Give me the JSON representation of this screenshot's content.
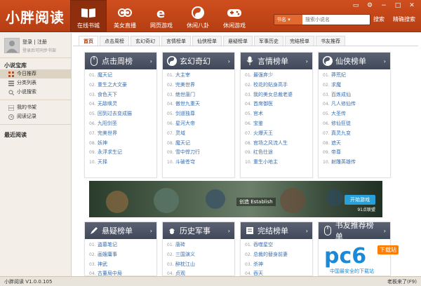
{
  "app": {
    "logo": "小胖阅读",
    "version": "小胖阅读 V1.0.0.105",
    "boss_key": "老板来了(F9)"
  },
  "nav": [
    {
      "label": "在线书城",
      "icon": "book-icon",
      "active": true
    },
    {
      "label": "美女直播",
      "icon": "owl-icon",
      "active": false
    },
    {
      "label": "网页游戏",
      "icon": "ie-icon",
      "active": false
    },
    {
      "label": "休闲八卦",
      "icon": "yinyang-icon",
      "active": false
    },
    {
      "label": "休闲游戏",
      "icon": "gamepad-icon",
      "active": false
    }
  ],
  "search": {
    "type": "书名",
    "placeholder": "搜索小说名",
    "button": "搜索",
    "precise": "精确搜索"
  },
  "sidebar": {
    "login": "登录",
    "sep": "|",
    "logout": "注册",
    "login_sub": "登录后可同步书架",
    "section1": "小说宝库",
    "items": [
      "今日推荐",
      "分类列表",
      "小说搜索"
    ],
    "items2": [
      "我的书架",
      "阅读记录"
    ],
    "section2": "最近阅读"
  },
  "tabs": [
    "首页",
    "点击周榜",
    "玄幻奇幻",
    "言情榜单",
    "仙侠榜单",
    "悬疑榜单",
    "军事历史",
    "完结榜单",
    "书友推荐"
  ],
  "panels": [
    {
      "title": "点击周榜",
      "icon": "mouse-icon",
      "items": [
        "魔天记",
        "重生之大文豪",
        "食色天下",
        "无敌唤灵",
        "回到过去变成猫",
        "九阳剑圣",
        "完美世界",
        "妖神",
        "永浮求生记",
        "天择"
      ]
    },
    {
      "title": "玄幻奇幻",
      "icon": "yinyang-icon",
      "items": [
        "大主宰",
        "完美世界",
        "绝世唐门",
        "傲世九重天",
        "剑道独尊",
        "星河大帝",
        "灵域",
        "魔天记",
        "雪中悍刀行",
        "斗破苍穹"
      ]
    },
    {
      "title": "言情榜单",
      "icon": "mic-icon",
      "items": [
        "最强弃少",
        "校花的贴身高手",
        "我的美女总裁老婆",
        "首席御医",
        "官术",
        "宝鉴",
        "火爆天王",
        "官场之风流人生",
        "红色仕途",
        "重生小地主"
      ]
    },
    {
      "title": "仙侠榜单",
      "icon": "yinyang-icon",
      "items": [
        "莽荒纪",
        "求魔",
        "百炼成仙",
        "凡人修仙传",
        "大圣传",
        "修仙狂徒",
        "真灵九变",
        "遮天",
        "帝尊",
        "射雕英雄传"
      ]
    }
  ],
  "panels2": [
    {
      "title": "悬疑榜单",
      "icon": "pen-icon",
      "items": [
        "盗墓笔记",
        "画嫂庸事",
        "神武",
        "古董局中局"
      ]
    },
    {
      "title": "历史军事",
      "icon": "soldier-icon",
      "items": [
        "唐砖",
        "三国演义",
        "醉枕江山",
        "贞观"
      ]
    },
    {
      "title": "完结榜单",
      "icon": "book-icon",
      "items": [
        "吞噬星空",
        "总裁的替身前妻",
        "杀神",
        "吞天"
      ]
    },
    {
      "title": "书友推荐榜单",
      "icon": "mouse-icon",
      "items": [
        "",
        "",
        "",
        ""
      ]
    }
  ],
  "banner": {
    "text": "创造 Establish",
    "button": "开始游戏",
    "sub": "91点联盟"
  },
  "watermark": {
    "big": "pc6",
    "tag": "下载站",
    "sub": "中国最安全的下载站"
  },
  "colors": {
    "topbar": "#c44a1a",
    "panel_head": "#4a5262",
    "link": "#3a6fb0"
  }
}
